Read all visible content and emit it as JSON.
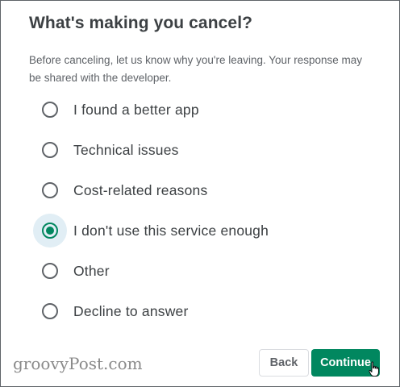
{
  "dialog": {
    "title": "What's making you cancel?",
    "description": "Before canceling, let us know why you're leaving. Your response may be shared with the developer."
  },
  "options": [
    {
      "label": "I found a better app",
      "selected": false
    },
    {
      "label": "Technical issues",
      "selected": false
    },
    {
      "label": "Cost-related reasons",
      "selected": false
    },
    {
      "label": "I don't use this service enough",
      "selected": true
    },
    {
      "label": "Other",
      "selected": false
    },
    {
      "label": "Decline to answer",
      "selected": false
    }
  ],
  "buttons": {
    "back_label": "Back",
    "continue_label": "Continue"
  },
  "watermark": "groovyPost.com",
  "colors": {
    "accent": "#01875f",
    "selected_halo": "#e1eef5",
    "text": "#3c4043"
  },
  "icons": {
    "cursor": "hand-pointer-icon"
  }
}
